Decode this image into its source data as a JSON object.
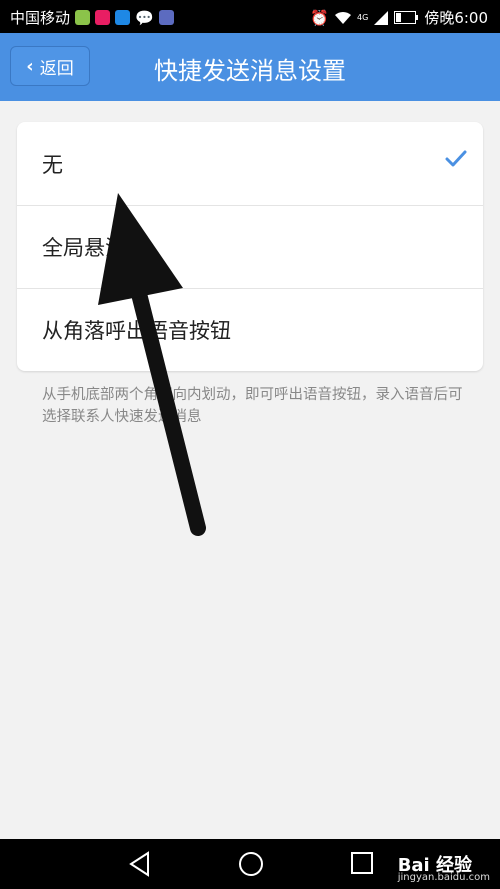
{
  "status_bar": {
    "carrier": "中国移动",
    "network": "4G",
    "time": "傍晚6:00"
  },
  "header": {
    "back_label": "返回",
    "title": "快捷发送消息设置"
  },
  "options": [
    {
      "label": "无",
      "selected": true
    },
    {
      "label": "全局悬浮球",
      "selected": false
    },
    {
      "label": "从角落呼出语音按钮",
      "selected": false
    }
  ],
  "hint": "从手机底部两个角落向内划动，即可呼出语音按钮，录入语音后可选择联系人快速发送消息",
  "watermark": {
    "brand": "Bai 经验",
    "url": "jingyan.baidu.com"
  },
  "colors": {
    "accent": "#4a90e2",
    "check": "#4a90e2"
  }
}
